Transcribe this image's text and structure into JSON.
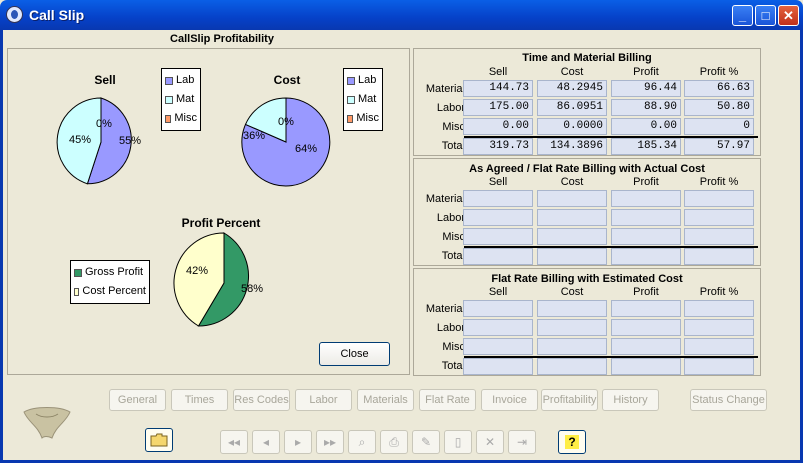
{
  "window": {
    "title": "Call Slip"
  },
  "main": {
    "title": "CallSlip Profitability",
    "sell_chart": {
      "title": "Sell",
      "lab_label": "55%",
      "mat_label": "45%",
      "misc_label": "0%"
    },
    "cost_chart": {
      "title": "Cost",
      "lab_label": "64%",
      "mat_label": "36%",
      "misc_label": "0%"
    },
    "profit_chart": {
      "title": "Profit Percent",
      "gross_label": "58%",
      "cost_label": "42%"
    },
    "legend_sell": [
      "Lab",
      "Mat",
      "Misc"
    ],
    "legend_cost": [
      "Lab",
      "Mat",
      "Misc"
    ],
    "legend_profit": [
      "Gross Profit",
      "Cost Percent"
    ],
    "close_label": "Close"
  },
  "chart_data": [
    {
      "type": "pie",
      "title": "Sell",
      "labels": [
        "Lab",
        "Mat",
        "Misc"
      ],
      "values": [
        55,
        45,
        0
      ],
      "colors": [
        "#9999ff",
        "#ccffff",
        "#ff9966"
      ],
      "legend": "right"
    },
    {
      "type": "pie",
      "title": "Cost",
      "labels": [
        "Lab",
        "Mat",
        "Misc"
      ],
      "values": [
        64,
        36,
        0
      ],
      "colors": [
        "#9999ff",
        "#ccffff",
        "#ff9966"
      ],
      "legend": "right"
    },
    {
      "type": "pie",
      "title": "Profit Percent",
      "labels": [
        "Gross Profit",
        "Cost Percent"
      ],
      "values": [
        58,
        42
      ],
      "colors": [
        "#339966",
        "#ffffcc"
      ],
      "legend": "left"
    }
  ],
  "columns": [
    "Sell",
    "Cost",
    "Profit",
    "Profit %"
  ],
  "rows": [
    "Material",
    "Labor",
    "Misc",
    "Total"
  ],
  "tm": {
    "title": "Time and Material Billing",
    "material": [
      "144.73",
      "48.2945",
      "96.44",
      "66.63"
    ],
    "labor": [
      "175.00",
      "86.0951",
      "88.90",
      "50.80"
    ],
    "misc": [
      "0.00",
      "0.0000",
      "0.00",
      "0"
    ],
    "total": [
      "319.73",
      "134.3896",
      "185.34",
      "57.97"
    ]
  },
  "agreed": {
    "title": "As Agreed / Flat Rate Billing with Actual Cost"
  },
  "flat": {
    "title": "Flat Rate Billing with Estimated Cost"
  },
  "tabs": [
    "General",
    "Times",
    "Res Codes",
    "Labor",
    "Materials",
    "Flat Rate",
    "Invoice",
    "Profitability",
    "History"
  ],
  "status_change": "Status Change",
  "nav": {
    "first": "◂◂",
    "prev": "◂",
    "next": "▸",
    "last": "▸▸",
    "help": "?"
  },
  "colors": {
    "lab": "#9999ff",
    "mat": "#ccffff",
    "misc": "#ff9966",
    "gross": "#339966",
    "costpct": "#ffffcc"
  }
}
